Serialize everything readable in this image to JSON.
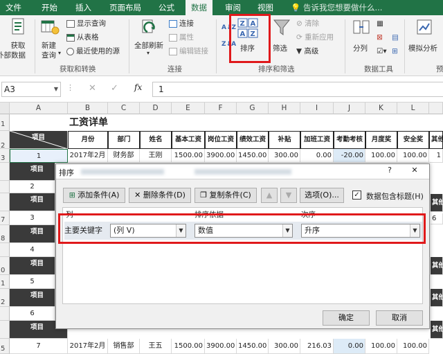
{
  "tabs": [
    "文件",
    "开始",
    "插入",
    "页面布局",
    "公式",
    "数据",
    "审阅",
    "视图"
  ],
  "active_tab": "数据",
  "tell_me": "告诉我您想要做什么...",
  "ribbon": {
    "get_data": "获取",
    "get_data2": "外部数据",
    "new_query": "新建",
    "new_query2": "查询",
    "show_queries": "显示查询",
    "from_table": "从表格",
    "recent_sources": "最近使用的源",
    "group_get_transform": "获取和转换",
    "refresh_all": "全部刷新",
    "connections": "连接",
    "properties": "属性",
    "edit_links": "编辑链接",
    "group_connections": "连接",
    "sort": "排序",
    "filter": "筛选",
    "clear": "清除",
    "reapply": "重新应用",
    "advanced": "高级",
    "group_sort_filter": "排序和筛选",
    "split": "分列",
    "group_data_tools": "数据工具",
    "whatif": "模拟分析",
    "forecast_cut": "预"
  },
  "formula_bar": {
    "name_box": "A3",
    "fx": "fx",
    "cancel": "✕",
    "enter": "✓",
    "value": "1"
  },
  "columns": [
    "A",
    "B",
    "C",
    "D",
    "E",
    "F",
    "G",
    "H",
    "I",
    "J",
    "K",
    "L"
  ],
  "rows": [
    "1",
    "2",
    "3",
    "4",
    "5",
    "6",
    "7",
    "8",
    "9",
    "0",
    "1",
    "2",
    "3",
    "4",
    "5",
    "6",
    "7",
    "8",
    "5"
  ],
  "sheet": {
    "title": "工资详单",
    "item_label": "项目",
    "headers": [
      "月份",
      "部门",
      "姓名",
      "基本工资",
      "岗位工资",
      "绩效工资",
      "补贴",
      "加班工资",
      "考勤考核",
      "月度奖",
      "安全奖",
      "其他"
    ],
    "row1": [
      "1",
      "2017年2月",
      "财务部",
      "王刚",
      "1500.00",
      "3900.00",
      "1450.00",
      "300.00",
      "0.00",
      "-20.00",
      "100.00",
      "100.00",
      "1"
    ],
    "row7": [
      "7",
      "2017年2月",
      "销售部",
      "王五",
      "1500.00",
      "3900.00",
      "1450.00",
      "300.00",
      "216.03",
      "0.00",
      "100.00",
      "100.00"
    ],
    "num2": "2",
    "num3": "3",
    "num4": "4",
    "num5": "5",
    "num6": "6",
    "side_other": "其他",
    "side_6": "6"
  },
  "dialog": {
    "title": "排序",
    "help": "?",
    "close": "✕",
    "add_level": "添加条件(A)",
    "delete_level": "删除条件(D)",
    "copy_level": "复制条件(C)",
    "options": "选项(O)...",
    "has_headers": "数据包含标题(H)",
    "col_header": "列",
    "sort_on_header": "排序依据",
    "order_header": "次序",
    "row_label": "主要关键字",
    "column_value": "(列 V)",
    "sort_on_value": "数值",
    "order_value": "升序",
    "ok": "确定",
    "cancel": "取消"
  },
  "colors": {
    "excel_green": "#217346",
    "highlight_red": "#e0191b",
    "dark_header": "#3a3a3a"
  }
}
